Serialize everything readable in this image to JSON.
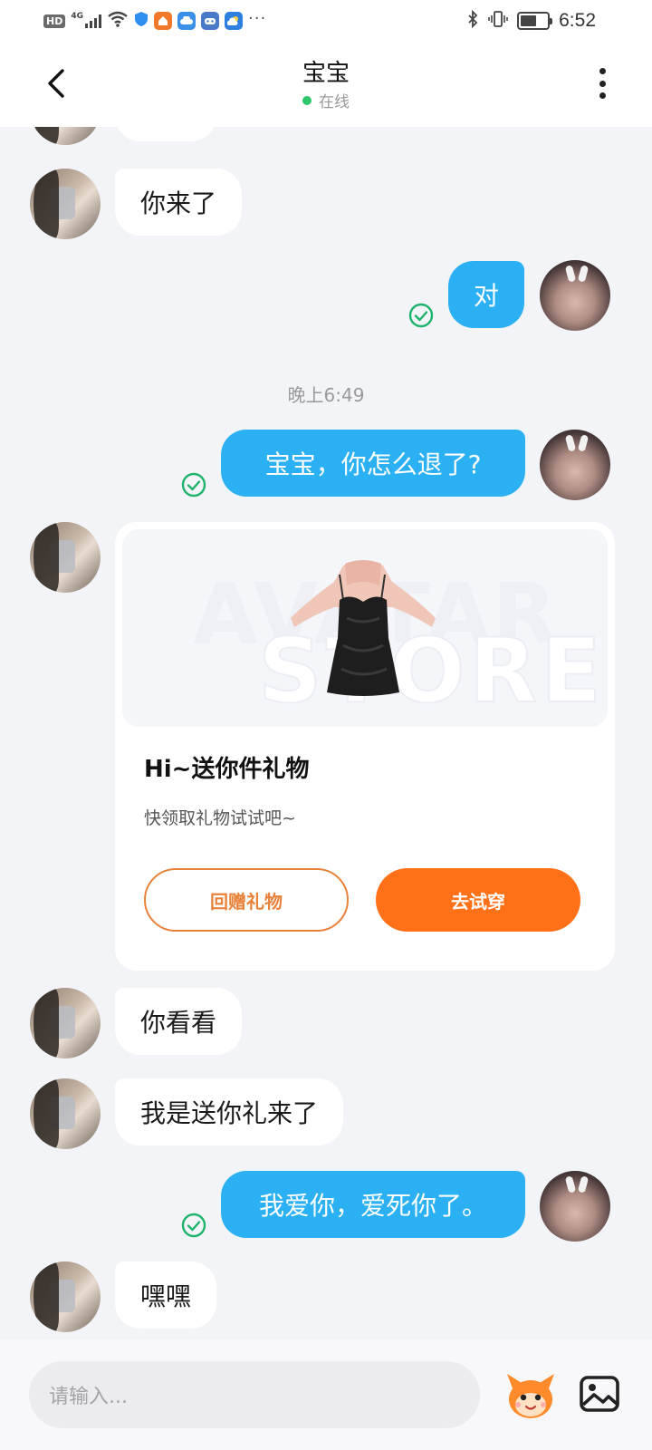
{
  "status_bar": {
    "hd": "HD",
    "network": "4G",
    "time": "6:52",
    "battery_level": 0.6,
    "more": "···",
    "icons": [
      "signal-icon",
      "wifi-icon",
      "shield-icon",
      "app-icon",
      "cloud-icon",
      "game-icon",
      "weather-icon",
      "bluetooth-icon",
      "vibrate-icon",
      "battery-icon"
    ]
  },
  "header": {
    "title": "宝宝",
    "status": "在线",
    "online_color": "#2cc76a"
  },
  "messages": [
    {
      "side": "in",
      "text": "你来了"
    },
    {
      "side": "out",
      "text": "对",
      "read": true
    },
    {
      "type": "time",
      "text": "晚上6:49"
    },
    {
      "side": "out",
      "text": "宝宝，你怎么退了?",
      "read": true
    },
    {
      "type": "gift_card",
      "title": "Hi~送你件礼物",
      "subtitle": "快领取礼物试试吧~",
      "watermark_top": "AVATAR",
      "watermark_bottom": "STORE",
      "button_return": "回赠礼物",
      "button_try": "去试穿"
    },
    {
      "side": "in",
      "text": "你看看"
    },
    {
      "side": "in",
      "text": "我是送你礼来了"
    },
    {
      "side": "out",
      "text": "我爱你，爱死你了。",
      "read": true
    },
    {
      "side": "in",
      "text": "嘿嘿"
    }
  ],
  "input": {
    "placeholder": "请输入..."
  },
  "colors": {
    "outgoing_bubble": "#2bb1f3",
    "read_check": "#1fb36b",
    "accent_orange": "#ff7017",
    "background": "#f3f4f8"
  }
}
